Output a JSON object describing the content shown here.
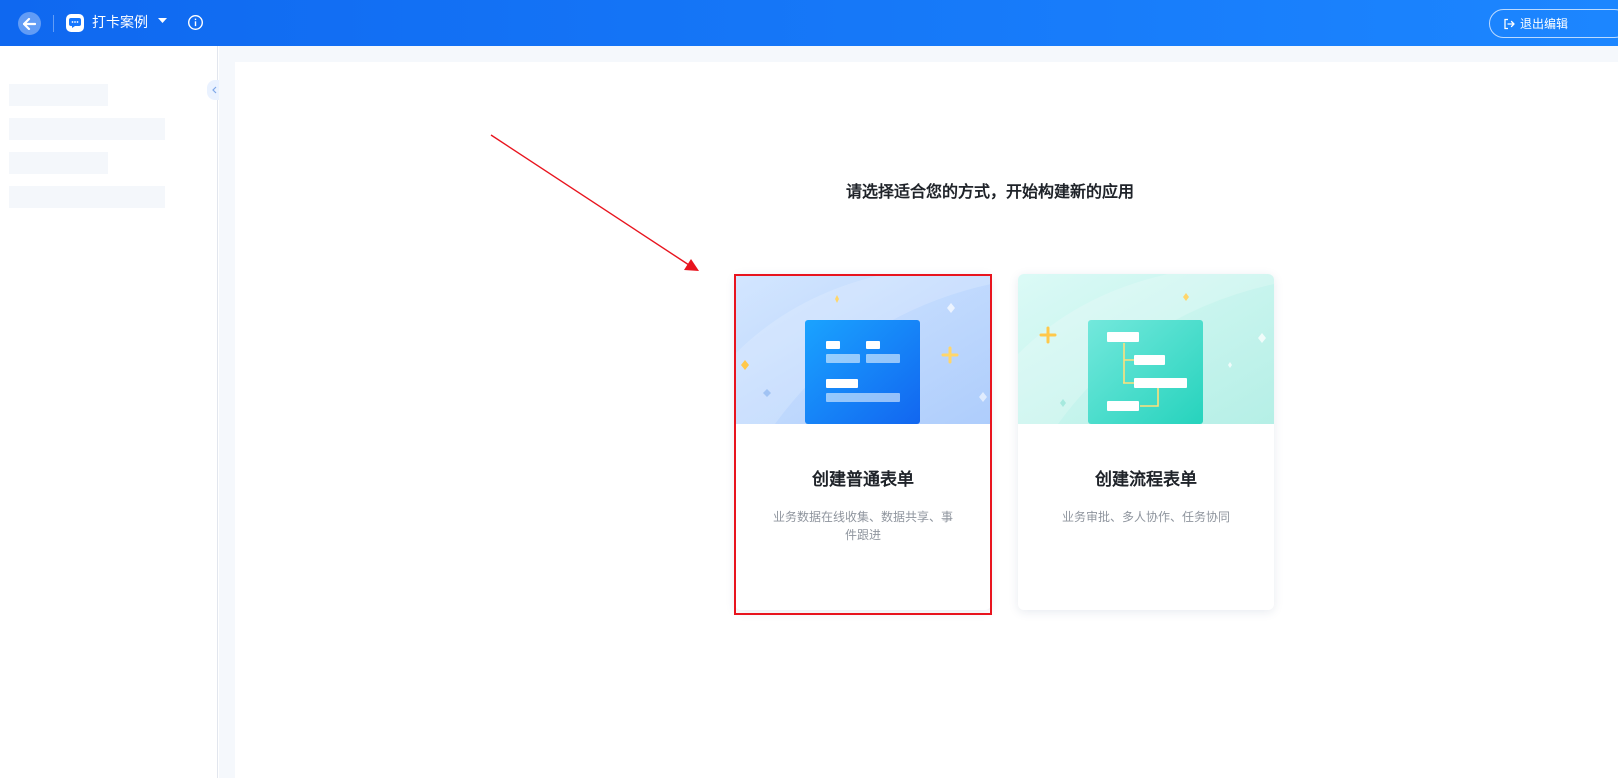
{
  "header": {
    "app_title": "打卡案例",
    "exit_label": "退出编辑",
    "icons": [
      "back-arrow-icon",
      "app-chat-icon",
      "caret-down-icon",
      "info-icon",
      "exit-icon"
    ]
  },
  "main": {
    "headline": "请选择适合您的方式，开始构建新的应用",
    "cards": [
      {
        "title": "创建普通表单",
        "description": "业务数据在线收集、数据共享、事件跟进"
      },
      {
        "title": "创建流程表单",
        "description": "业务审批、多人协作、任务协同"
      }
    ]
  },
  "colors": {
    "topbar_start": "#0f68f0",
    "topbar_end": "#1c86ff",
    "highlight": "#e8141e",
    "card1_accent": "#1677ff",
    "card2_accent": "#2fd9c4"
  }
}
